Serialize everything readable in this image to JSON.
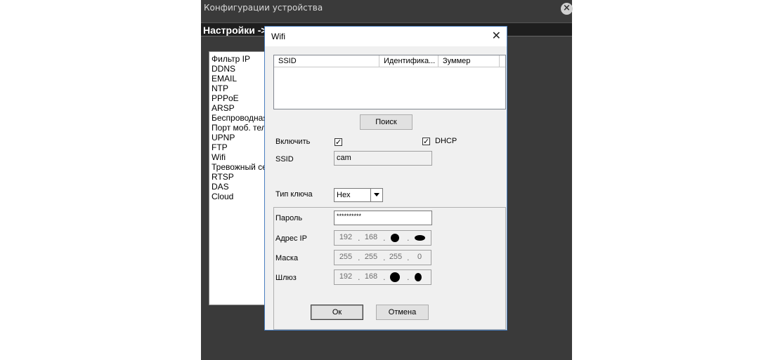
{
  "outer_window": {
    "title": "Конфигурации устройства",
    "tab_label": "Настройки ->",
    "menu_items": [
      "Фильтр IP",
      "DDNS",
      "EMAIL",
      "NTP",
      "PPPoE",
      "ARSP",
      "Беспроводная",
      "Порт моб. теле",
      "UPNP",
      "FTP",
      "Wifi",
      "Тревожный сер",
      "RTSP",
      "DAS",
      "Cloud"
    ]
  },
  "dialog": {
    "title": "Wifi",
    "close_glyph": "✕",
    "list_columns": [
      "SSID",
      "Идентифика...",
      "Зуммер"
    ],
    "search_button": "Поиск",
    "enable_label": "Включить",
    "enable_checked": true,
    "dhcp_label": "DHCP",
    "dhcp_checked": true,
    "ssid_label": "SSID",
    "ssid_value": "cam",
    "key_type_label": "Тип ключа",
    "key_type_value": "Hex",
    "password_label": "Пароль",
    "password_value": "**********",
    "ip_label": "Адрес IP",
    "ip_octets": [
      "192",
      "168",
      "",
      ""
    ],
    "mask_label": "Маска",
    "mask_octets": [
      "255",
      "255",
      "255",
      "0"
    ],
    "gateway_label": "Шлюз",
    "gateway_octets": [
      "192",
      "168",
      "",
      ""
    ],
    "ok_button": "Ок",
    "cancel_button": "Отмена"
  }
}
